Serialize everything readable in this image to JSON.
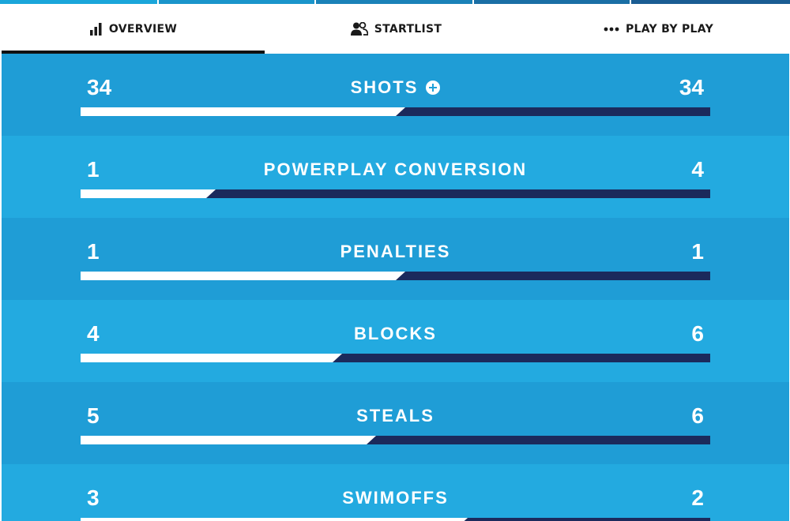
{
  "colors": {
    "row_dark": "#1f9dd6",
    "row_light": "#23aae0",
    "bar_right": "#1b2a5c",
    "bar_left": "#ffffff",
    "strip": [
      "#1aa6da",
      "#1a8fc4",
      "#1a7ab0",
      "#1a6aa0",
      "#1a5a90"
    ]
  },
  "tabs": [
    {
      "label": "OVERVIEW",
      "icon": "bar-chart-icon",
      "active": true
    },
    {
      "label": "STARTLIST",
      "icon": "users-icon",
      "active": false
    },
    {
      "label": "PLAY BY PLAY",
      "icon": "dots-icon",
      "active": false
    }
  ],
  "stats": [
    {
      "label": "SHOTS",
      "left": "34",
      "right": "34",
      "left_share": 0.5,
      "has_expand": true
    },
    {
      "label": "POWERPLAY CONVERSION",
      "left": "1",
      "right": "4",
      "left_share": 0.2,
      "has_expand": false
    },
    {
      "label": "PENALTIES",
      "left": "1",
      "right": "1",
      "left_share": 0.5,
      "has_expand": false
    },
    {
      "label": "BLOCKS",
      "left": "4",
      "right": "6",
      "left_share": 0.4,
      "has_expand": false
    },
    {
      "label": "STEALS",
      "left": "5",
      "right": "6",
      "left_share": 0.4545,
      "has_expand": false
    },
    {
      "label": "SWIMOFFS",
      "left": "3",
      "right": "2",
      "left_share": 0.6,
      "has_expand": false
    }
  ]
}
